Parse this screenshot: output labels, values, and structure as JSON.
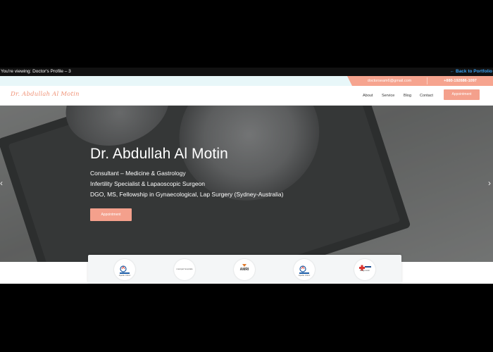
{
  "viewbar": {
    "text": "You're viewing: Doctor's Profile – 3",
    "back_link": "← Back to Portfolio"
  },
  "contact": {
    "email": "doctorseam6@gmail.com",
    "phone": "+880-192686-1097"
  },
  "header": {
    "logo": "Dr. Abdullah Al Motin",
    "nav": [
      "About",
      "Service",
      "Blog",
      "Contact"
    ],
    "appointment": "Appointment"
  },
  "hero": {
    "name": "Dr. Abdullah Al Motin",
    "lines": [
      "Consultant – Medicine & Gastrology",
      "Infertility Specialist & Lapaoscopic Surgeon",
      "DGO, MS, Fellowship in Gynaecological, Lap Surgery (Sydney-Australia)"
    ],
    "appointment": "Appointment",
    "arrow_left": "‹",
    "arrow_right": "›"
  },
  "partners": {
    "items": [
      {
        "label": "Apollo Clinic"
      },
      {
        "label": "manipal hospitals"
      },
      {
        "label": "AMRI"
      },
      {
        "label": "Apollo Clinic"
      },
      {
        "label": "Diagnostic"
      }
    ]
  },
  "colors": {
    "accent": "#f4a08c",
    "strip": "#e8f7f9",
    "link": "#3aa0f0"
  }
}
